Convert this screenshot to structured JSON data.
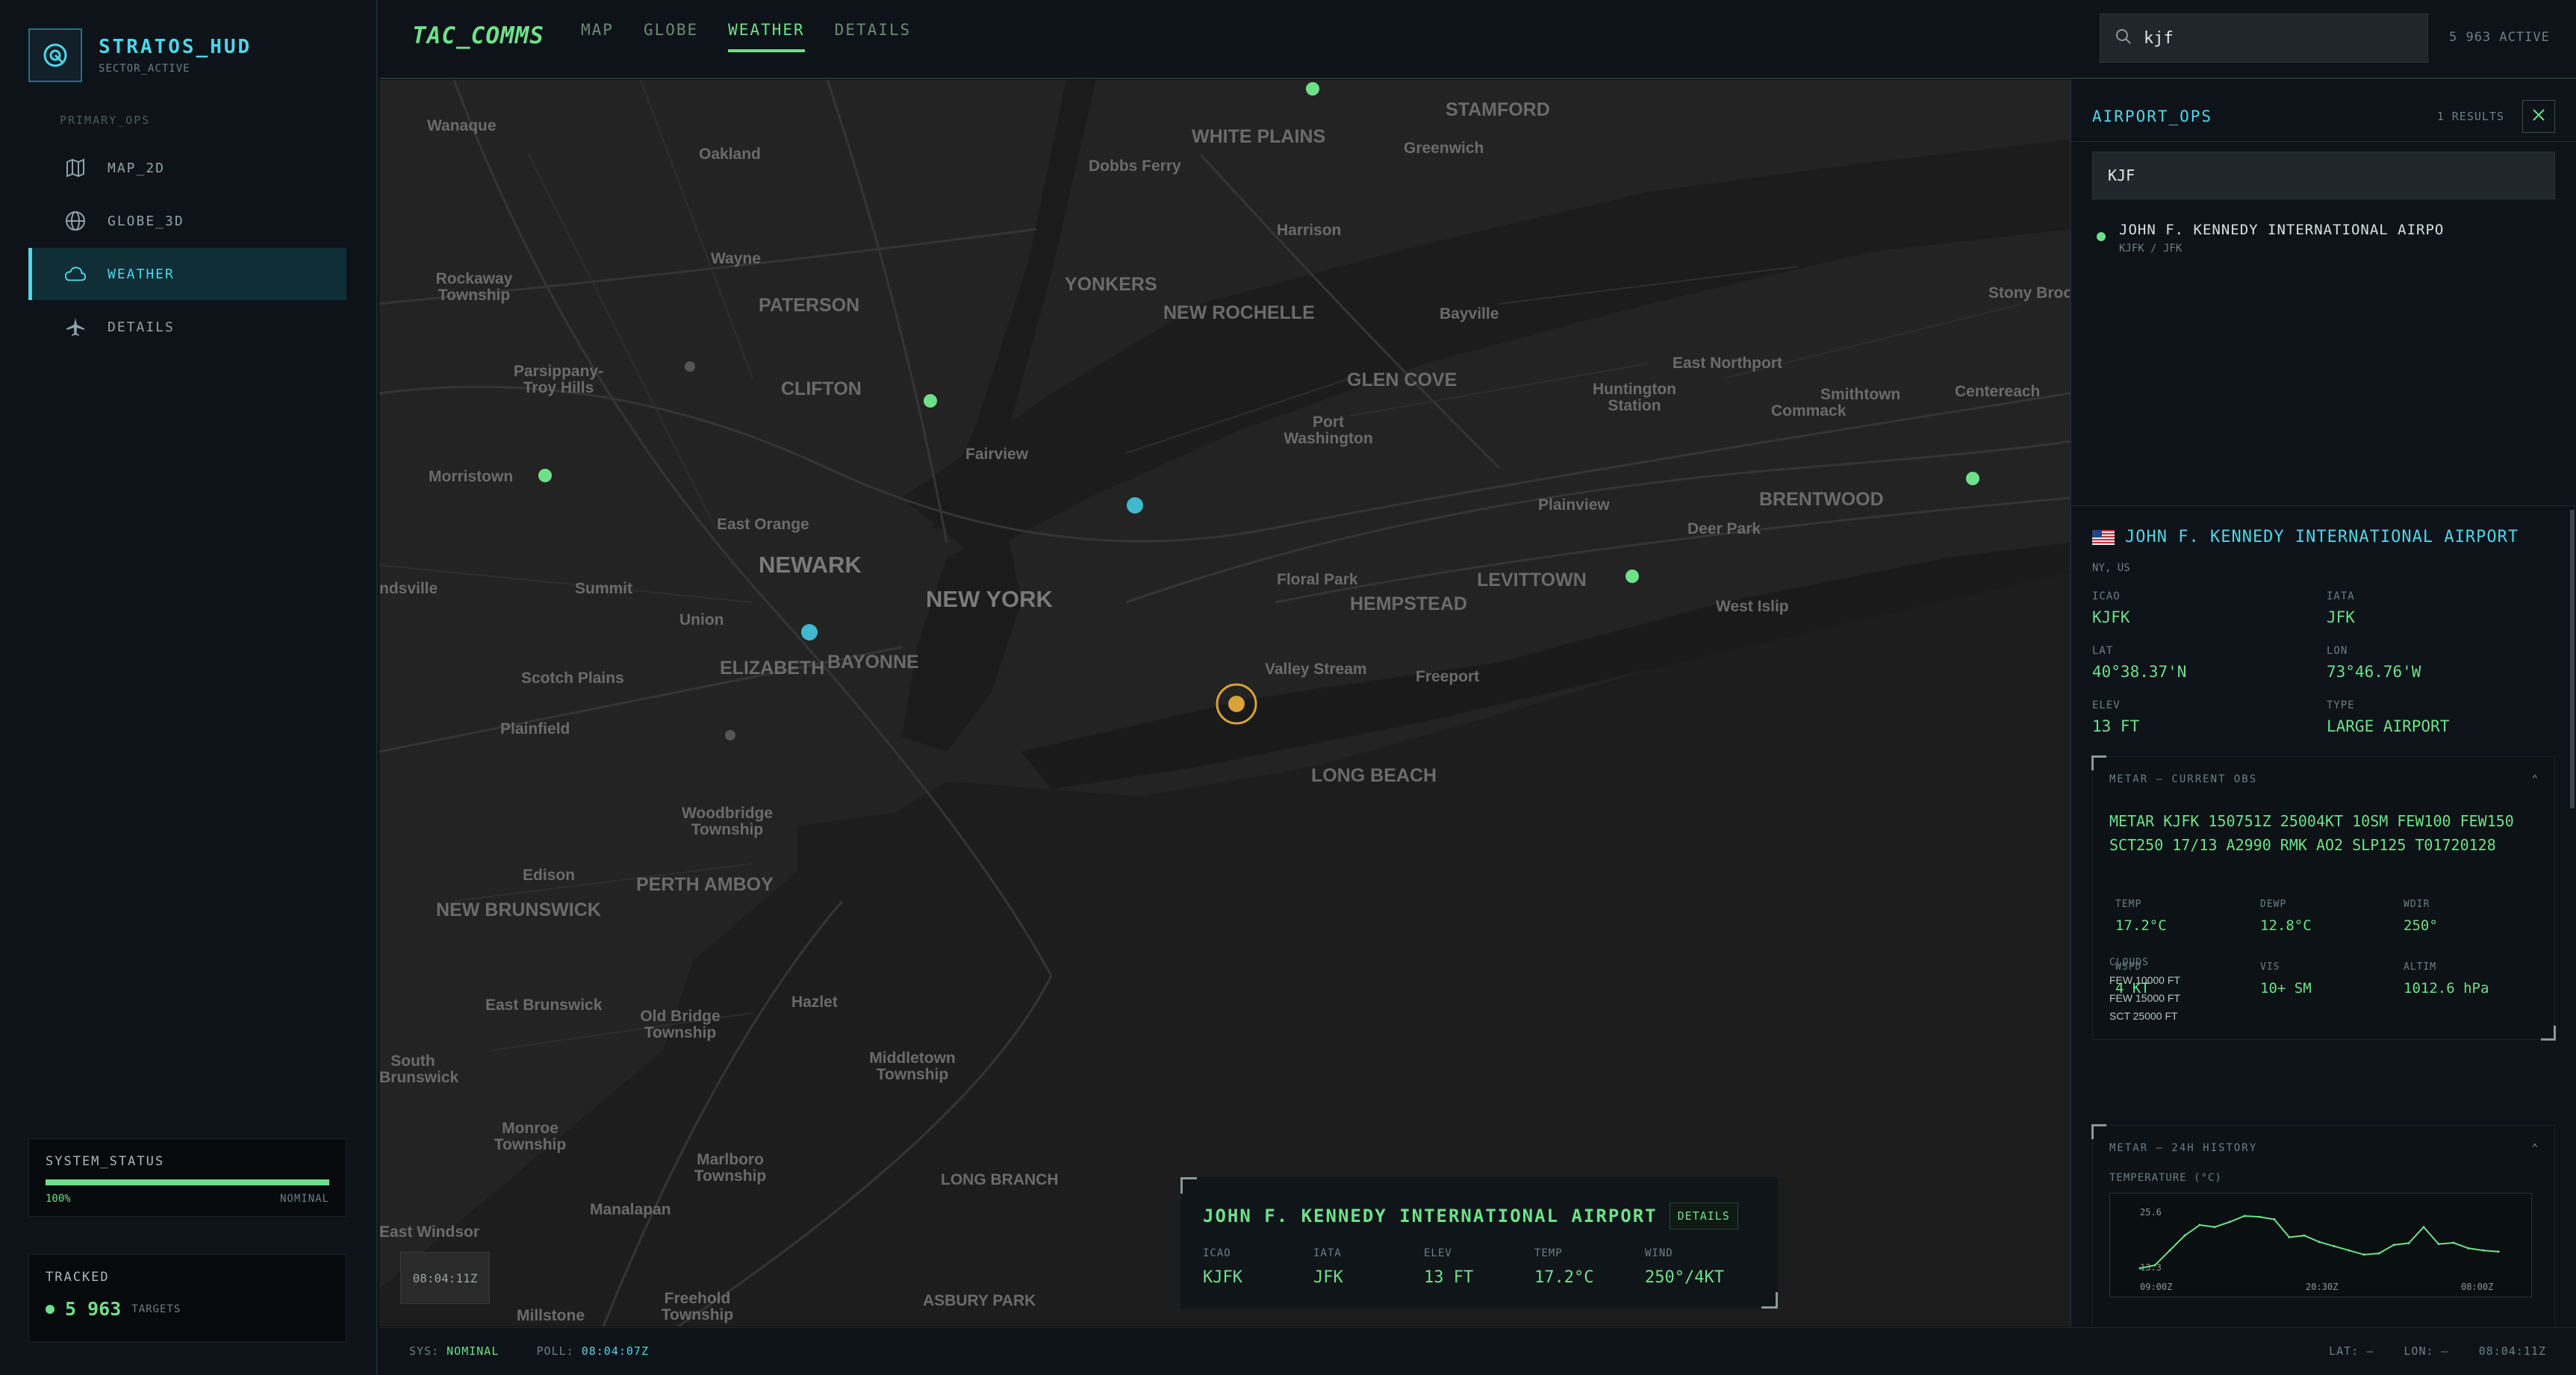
{
  "brand": {
    "title": "STRATOS_HUD",
    "subtitle": "SECTOR_ACTIVE"
  },
  "sidebar": {
    "section_label": "PRIMARY_OPS",
    "items": [
      {
        "label": "MAP_2D",
        "icon": "map-icon",
        "active": false
      },
      {
        "label": "GLOBE_3D",
        "icon": "globe-icon",
        "active": false
      },
      {
        "label": "WEATHER",
        "icon": "cloud-icon",
        "active": true
      },
      {
        "label": "DETAILS",
        "icon": "plane-icon",
        "active": false
      }
    ]
  },
  "system_status": {
    "title": "SYSTEM_STATUS",
    "percent_label": "100%",
    "progress": 1.0,
    "state": "NOMINAL"
  },
  "tracked": {
    "title": "TRACKED",
    "count": "5 963",
    "unit": "TARGETS"
  },
  "header": {
    "app_title": "TAC_COMMS",
    "tabs": [
      {
        "label": "MAP",
        "active": false
      },
      {
        "label": "GLOBE",
        "active": false
      },
      {
        "label": "WEATHER",
        "active": true
      },
      {
        "label": "DETAILS",
        "active": false
      }
    ],
    "search_value": "kjf",
    "active_count": "5 963 ACTIVE"
  },
  "map": {
    "time_chip": "08:04:11Z",
    "labels": [
      "Wanaque",
      "Oakland",
      "WHITE PLAINS",
      "STAMFORD",
      "Greenwich",
      "Dobbs Ferry",
      "Harrison",
      "Rockaway Township",
      "Wayne",
      "PATERSON",
      "YONKERS",
      "NEW ROCHELLE",
      "Bayville",
      "Stony Brook",
      "Parsippany-Troy Hills",
      "CLIFTON",
      "GLEN COVE",
      "East Northport",
      "Huntington Station",
      "Smithtown",
      "Centereach",
      "Fairview",
      "Port Washington",
      "Commack",
      "Morristown",
      "East Orange",
      "NEWARK",
      "BRENTWOOD",
      "Plainview",
      "Deer Park",
      "Summit",
      "NEW YORK",
      "Floral Park",
      "LEVITTOWN",
      "HEMPSTEAD",
      "West Islip",
      "Union",
      "ELIZABETH",
      "BAYONNE",
      "Valley Stream",
      "Freeport",
      "Scotch Plains",
      "Plainfield",
      "LONG BEACH",
      "Woodbridge Township",
      "Edison",
      "PERTH AMBOY",
      "NEW BRUNSWICK",
      "East Brunswick",
      "Old Bridge Township",
      "Hazlet",
      "South Brunswick",
      "Middletown Township",
      "Monroe Township",
      "Marlboro Township",
      "LONG BRANCH",
      "Manalapan",
      "East Windsor",
      "Freehold Township",
      "Millstone",
      "ASBURY PARK",
      "ndsville"
    ]
  },
  "popup": {
    "title": "JOHN F. KENNEDY INTERNATIONAL AIRPORT",
    "details_label": "DETAILS",
    "fields": [
      {
        "k": "ICAO",
        "v": "KJFK"
      },
      {
        "k": "IATA",
        "v": "JFK"
      },
      {
        "k": "ELEV",
        "v": "13 FT"
      },
      {
        "k": "TEMP",
        "v": "17.2°C"
      },
      {
        "k": "WIND",
        "v": "250°/4KT"
      }
    ]
  },
  "status_bar": {
    "sys_label": "SYS:",
    "sys_value": "NOMINAL",
    "poll_label": "POLL:",
    "poll_value": "08:04:07Z",
    "lat_label": "LAT: —",
    "lon_label": "LON: —",
    "clock": "08:04:11Z"
  },
  "panel": {
    "title": "AIRPORT_OPS",
    "results": "1 RESULTS",
    "query": "KJF",
    "result": {
      "name": "JOHN F. KENNEDY INTERNATIONAL AIRPO",
      "codes": "KJFK / JFK"
    },
    "airport": {
      "name": "JOHN F. KENNEDY INTERNATIONAL AIRPORT",
      "location": "NY, US",
      "fields": [
        {
          "k": "ICAO",
          "v": "KJFK"
        },
        {
          "k": "IATA",
          "v": "JFK"
        },
        {
          "k": "LAT",
          "v": "40°38.37'N"
        },
        {
          "k": "LON",
          "v": "73°46.76'W"
        },
        {
          "k": "ELEV",
          "v": "13 FT"
        },
        {
          "k": "TYPE",
          "v": "LARGE AIRPORT"
        }
      ]
    },
    "metar": {
      "title": "METAR — CURRENT OBS",
      "raw": "METAR KJFK 150751Z 25004KT 10SM FEW100 FEW150 SCT250 17/13 A2990 RMK AO2 SLP125 T01720128",
      "fields": [
        {
          "k": "TEMP",
          "v": "17.2°C"
        },
        {
          "k": "DEWP",
          "v": "12.8°C"
        },
        {
          "k": "WDIR",
          "v": "250°"
        },
        {
          "k": "WSPD",
          "v": "4 KT"
        },
        {
          "k": "VIS",
          "v": "10+ SM"
        },
        {
          "k": "ALTIM",
          "v": "1012.6 hPa"
        }
      ],
      "clouds_label": "CLOUDS",
      "clouds": [
        "FEW 10000 FT",
        "FEW 15000 FT",
        "SCT 25000 FT"
      ]
    },
    "history": {
      "title": "METAR — 24H HISTORY",
      "subtitle": "TEMPERATURE (°C)",
      "max_label": "25.6",
      "min_label": "13.3",
      "x_labels": [
        "09:00Z",
        "20:30Z",
        "08:00Z"
      ]
    }
  },
  "chart_data": {
    "type": "line",
    "title": "TEMPERATURE (°C)",
    "x": [
      "09:00Z",
      "",
      "",
      "",
      "",
      "",
      "",
      "",
      "",
      "",
      "",
      "",
      "20:30Z",
      "",
      "",
      "",
      "",
      "",
      "",
      "",
      "",
      "",
      "",
      "",
      "08:00Z"
    ],
    "series": [
      {
        "values": [
          13.3,
          14.0,
          17.5,
          21.0,
          23.5,
          23.0,
          24.2,
          25.6,
          25.4,
          24.8,
          20.6,
          21.0,
          19.5,
          18.5,
          17.5,
          16.5,
          16.8,
          18.8,
          19.2,
          23.0,
          19.0,
          19.3,
          18.0,
          17.5,
          17.2
        ]
      }
    ],
    "ylim": [
      13.3,
      25.6
    ]
  },
  "colors": {
    "accent_cyan": "#4fd6e8",
    "accent_green": "#6fe08a",
    "amber": "#d9a23a"
  }
}
